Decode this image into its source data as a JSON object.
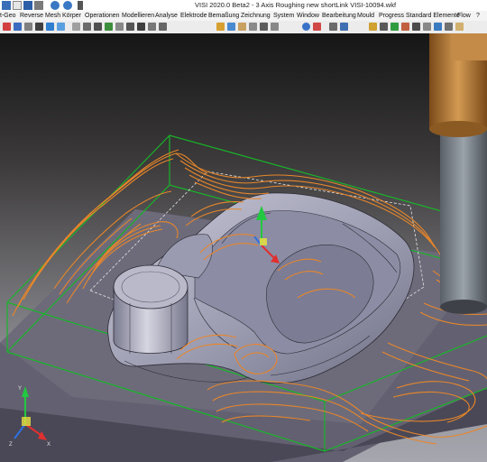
{
  "window": {
    "title": "VISI 2020.0 Beta2 - 3 Axis Roughing new shortLink VISI-10094.wkf"
  },
  "menubar": {
    "items": [
      {
        "id": "wirgeo",
        "label": "t-Geo"
      },
      {
        "id": "reverse",
        "label": "Reverse"
      },
      {
        "id": "mesh",
        "label": "Mesh"
      },
      {
        "id": "koerper",
        "label": "Körper"
      },
      {
        "id": "operationen",
        "label": "Operationen"
      },
      {
        "id": "modellieren",
        "label": "Modellieren"
      },
      {
        "id": "analyse",
        "label": "Analyse"
      },
      {
        "id": "elektrode",
        "label": "Elektrode"
      },
      {
        "id": "bemassung",
        "label": "Bemaßung"
      },
      {
        "id": "zeichnung",
        "label": "Zeichnung"
      },
      {
        "id": "system",
        "label": "System"
      },
      {
        "id": "window",
        "label": "Window"
      },
      {
        "id": "bearbeitung",
        "label": "Bearbeitung"
      },
      {
        "id": "mould",
        "label": "Mould"
      },
      {
        "id": "progress",
        "label": "Progress"
      },
      {
        "id": "standard-elemente",
        "label": "Standard Elemente"
      },
      {
        "id": "flow",
        "label": "Flow"
      },
      {
        "id": "overflow",
        "label": "?"
      }
    ]
  },
  "colors": {
    "toolpath": "#e8862a",
    "stock_box": "#19b52a",
    "part": "#a9a9bd",
    "base_plate": "#676572"
  },
  "icons": {
    "gizmo": "axis-triad-icon",
    "triad": "world-axis-icon"
  }
}
